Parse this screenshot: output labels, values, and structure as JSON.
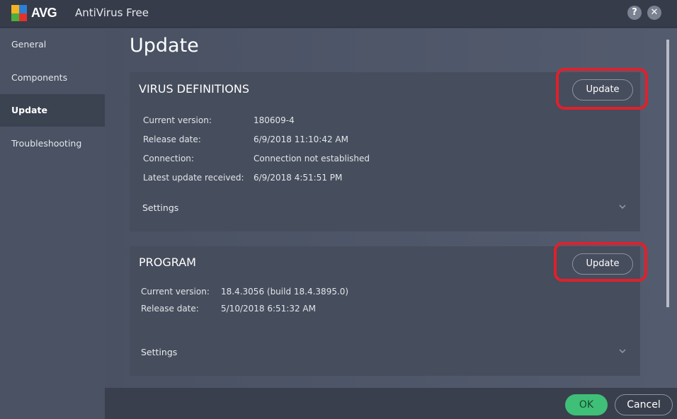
{
  "titlebar": {
    "brand": "AVG",
    "app_title": "AntiVirus Free",
    "help_label": "?",
    "close_label": "✕"
  },
  "sidebar": {
    "items": [
      {
        "label": "General",
        "active": false
      },
      {
        "label": "Components",
        "active": false
      },
      {
        "label": "Update",
        "active": true
      },
      {
        "label": "Troubleshooting",
        "active": false
      }
    ]
  },
  "main": {
    "title": "Update",
    "virus_definitions": {
      "title": "VIRUS DEFINITIONS",
      "update_label": "Update",
      "rows": [
        {
          "label": "Current version:",
          "value": "180609-4"
        },
        {
          "label": "Release date:",
          "value": "6/9/2018 11:10:42 AM"
        },
        {
          "label": "Connection:",
          "value": "Connection not established"
        },
        {
          "label": "Latest update received:",
          "value": "6/9/2018 4:51:51 PM"
        }
      ],
      "settings_label": "Settings"
    },
    "program": {
      "title": "PROGRAM",
      "update_label": "Update",
      "rows": [
        {
          "label": "Current version:",
          "value": "18.4.3056 (build 18.4.3895.0)"
        },
        {
          "label": "Release date:",
          "value": "5/10/2018 6:51:32 AM"
        }
      ],
      "settings_label": "Settings"
    }
  },
  "footer": {
    "ok_label": "OK",
    "cancel_label": "Cancel"
  },
  "colors": {
    "accent_green": "#3fbf77",
    "annotation_red": "#e0202c"
  }
}
